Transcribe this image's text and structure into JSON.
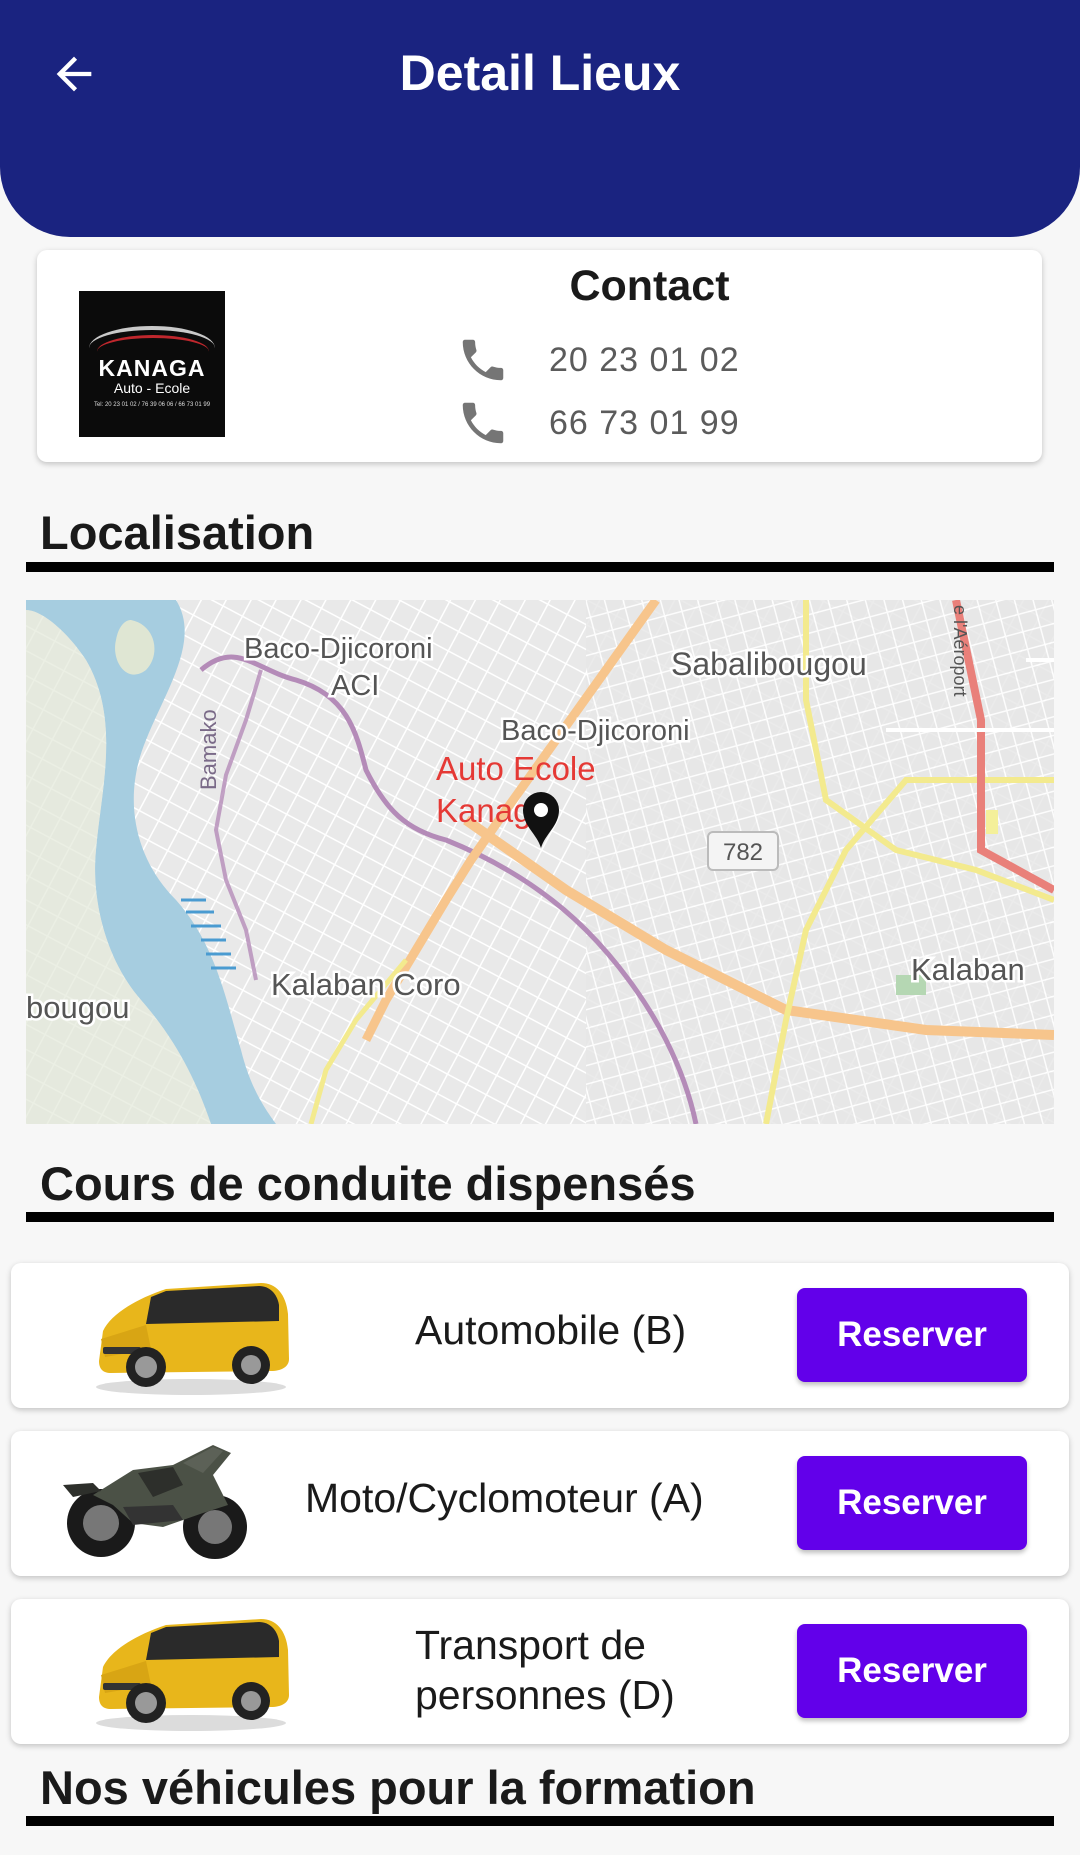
{
  "appbar": {
    "title": "Detail Lieux",
    "bg_color": "#1a2380"
  },
  "contact": {
    "title": "Contact",
    "logo": {
      "brand": "KANAGA",
      "sub": "Auto - Ecole",
      "tel": "Tel: 20 23 01 02 / 76 39 06 06 / 66 73 01 99"
    },
    "phones": [
      "20 23 01 02",
      "66 73 01 99"
    ]
  },
  "sections": {
    "localisation": "Localisation",
    "cours": "Cours de conduite dispensés",
    "vehicules": "Nos véhicules pour la formation"
  },
  "map": {
    "labels": {
      "baco_aci": "Baco-Djicoroni",
      "aci": "ACI",
      "sabali": "Sabalibougou",
      "baco": "Baco-Djicoroni",
      "bamako": "Bamako",
      "place_line1": "Auto Ecole",
      "place_line2": "Kanaga",
      "road_badge": "782",
      "kalaban": "Kalaban",
      "kalaban_coro": "Kalaban Coro",
      "bougou": "bougou",
      "aeroport": "e l'Aéroport"
    },
    "place_color": "#e53935"
  },
  "courses": [
    {
      "label": "Automobile (B)",
      "icon": "van-image",
      "button": "Reserver"
    },
    {
      "label": "Moto/Cyclomoteur (A)",
      "icon": "motorcycle-image",
      "button": "Reserver"
    },
    {
      "label_line1": "Transport de",
      "label_line2": "personnes (D)",
      "icon": "van-image",
      "button": "Reserver"
    }
  ],
  "accent_color": "#6200ea"
}
